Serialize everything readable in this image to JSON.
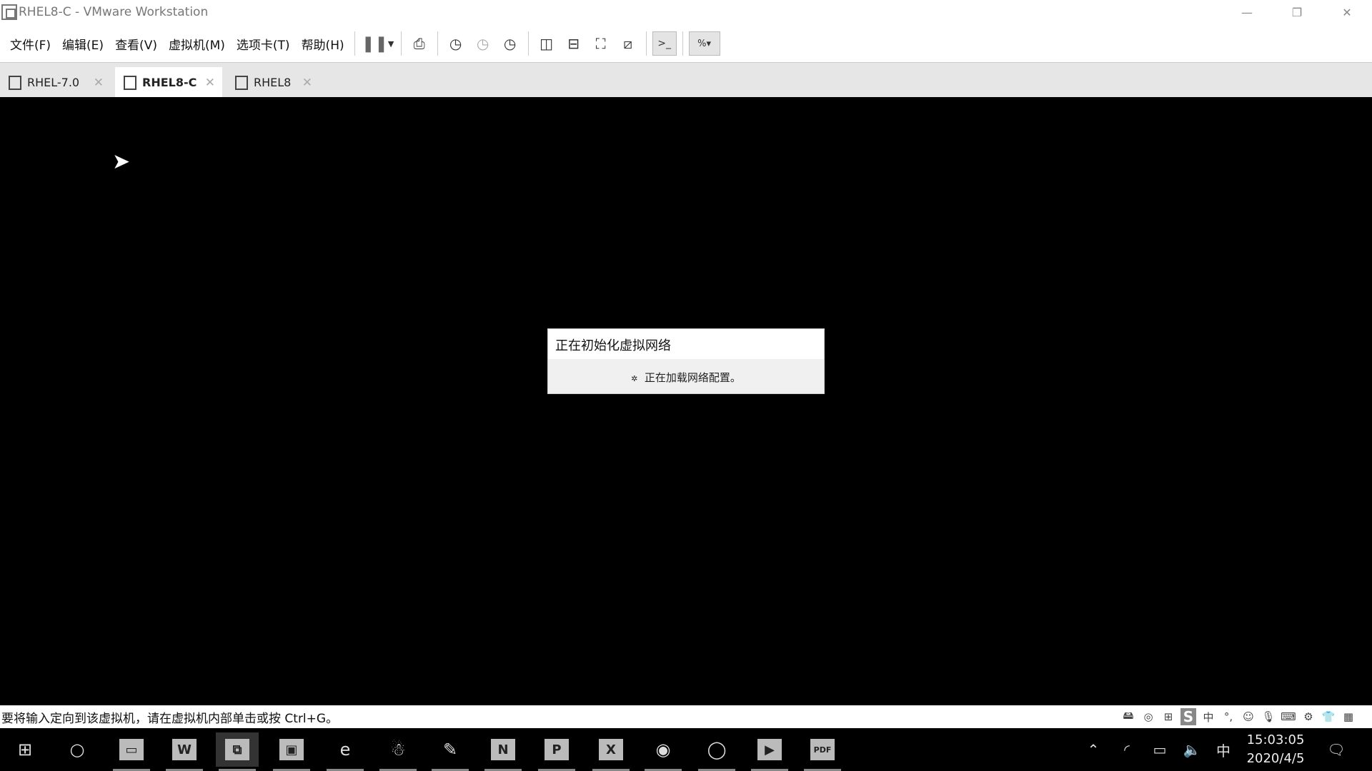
{
  "window": {
    "title": "RHEL8-C - VMware Workstation",
    "controls": [
      "minimize",
      "restore",
      "close"
    ]
  },
  "menu": [
    "文件(F)",
    "编辑(E)",
    "查看(V)",
    "虚拟机(M)",
    "选项卡(T)",
    "帮助(H)"
  ],
  "toolbar_icons": [
    "pause-icon",
    "send-ctrl-alt-del-icon",
    "snapshot-icon",
    "revert-snapshot-icon",
    "snapshot-manager-icon",
    "library-view-icon",
    "thumbnail-bar-icon",
    "full-screen-icon",
    "unity-icon",
    "console-view-icon",
    "stretch-view-icon"
  ],
  "tabs": [
    {
      "label": "RHEL-7.0",
      "active": false
    },
    {
      "label": "RHEL8-C",
      "active": true
    },
    {
      "label": "RHEL8",
      "active": false
    }
  ],
  "dialog": {
    "title": "正在初始化虚拟网络",
    "message": "正在加载网络配置。"
  },
  "status": {
    "message": "要将输入定向到该虚拟机，请在虚拟机内部单击或按 Ctrl+G。",
    "icons": [
      "hard-disk-icon",
      "cd-rom-icon",
      "network-icon",
      "sogou-icon",
      "chinese-input-icon",
      "punctuation-icon",
      "emoji-icon",
      "microphone-icon",
      "keyboard-icon",
      "settings-icon",
      "skin-icon",
      "toolbox-icon"
    ],
    "icon_glyphs": [
      "🖴",
      "◎",
      "⊞",
      "S",
      "中",
      "°,",
      "☺",
      "🎙",
      "⌨",
      "⚙",
      "👕",
      "▦"
    ]
  },
  "taskbar": {
    "apps": [
      "start-icon",
      "cortana-icon",
      "file-explorer-icon",
      "word-icon",
      "vmware-icon",
      "screenshot-icon",
      "ie-icon",
      "qq-icon",
      "paint-icon",
      "onenote-icon",
      "powerpoint-icon",
      "xshell-icon",
      "firefox-icon",
      "chrome-icon",
      "zoom-icon",
      "pdf-icon"
    ],
    "app_glyphs": [
      "⊞",
      "○",
      "▭",
      "W",
      "⧉",
      "▣",
      "e",
      "☃",
      "✎",
      "N",
      "P",
      "X",
      "◉",
      "◯",
      "▶",
      "PDF"
    ],
    "ime": "中",
    "time": "15:03:05",
    "date": "2020/4/5"
  }
}
